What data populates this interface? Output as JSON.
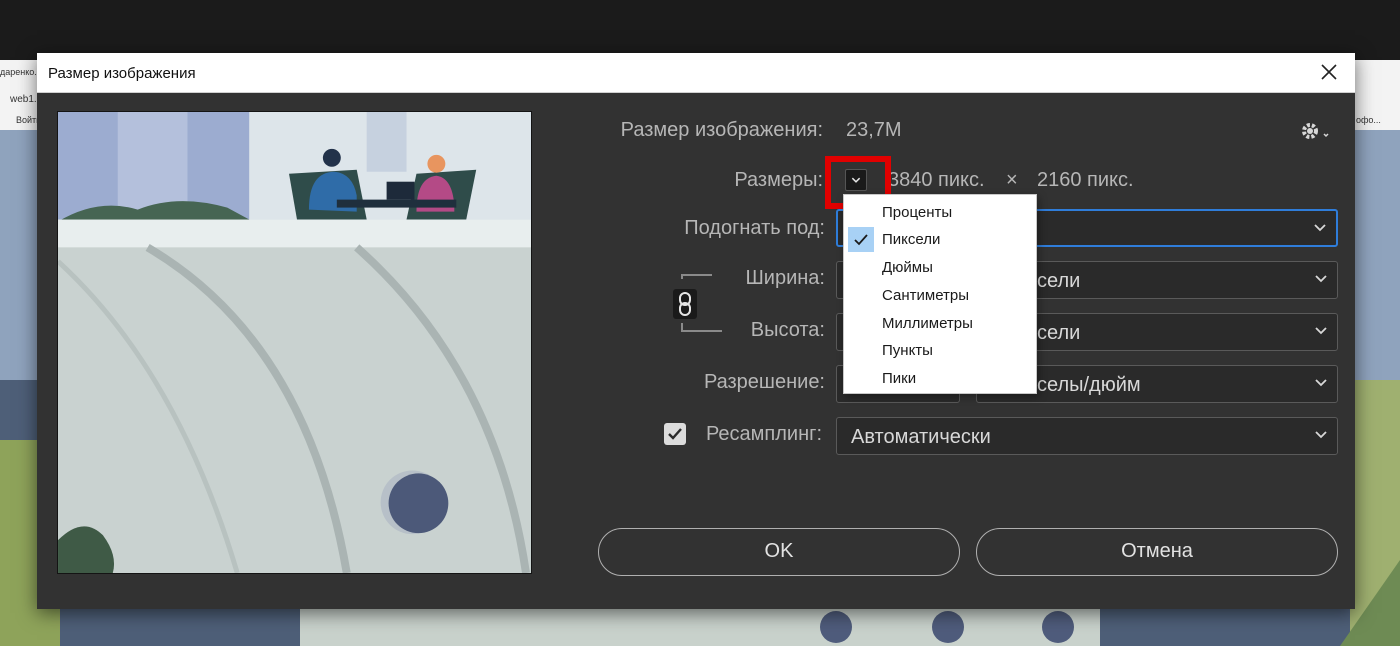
{
  "browser": {
    "tab_fragment": "даренко. К",
    "url_fragment": "web1.",
    "bookmark_fragment": "Войти",
    "bookmark_right": "офо..."
  },
  "dialog": {
    "title": "Размер изображения",
    "image_size_label": "Размер изображения:",
    "image_size_value": "23,7M",
    "dimensions_label": "Размеры:",
    "width_value": "3840 пикс.",
    "times": "×",
    "height_value": "2160 пикс.",
    "fit_label": "Подогнать под:",
    "width_label": "Ширина:",
    "height_label": "Высота:",
    "resolution_label": "Разрешение:",
    "width_unit_visible": "сели",
    "height_unit_visible": "сели",
    "resolution_unit_visible": "селы/дюйм",
    "resample_label": "Ресамплинг:",
    "resample_checked": true,
    "resample_value": "Автоматически",
    "ok_label": "OK",
    "cancel_label": "Отмена"
  },
  "unit_menu": {
    "items": [
      "Проценты",
      "Пиксели",
      "Дюймы",
      "Сантиметры",
      "Миллиметры",
      "Пункты",
      "Пики"
    ],
    "selected": "Пиксели"
  },
  "colors": {
    "dialog_bg": "#323232",
    "focus_blue": "#2f7dda",
    "highlight_red": "#e10000",
    "menu_check_bg": "#a8d1f5"
  },
  "icons": [
    "close-icon",
    "gear-icon",
    "chevron-down-icon",
    "link-chain-icon",
    "checkmark-icon"
  ]
}
